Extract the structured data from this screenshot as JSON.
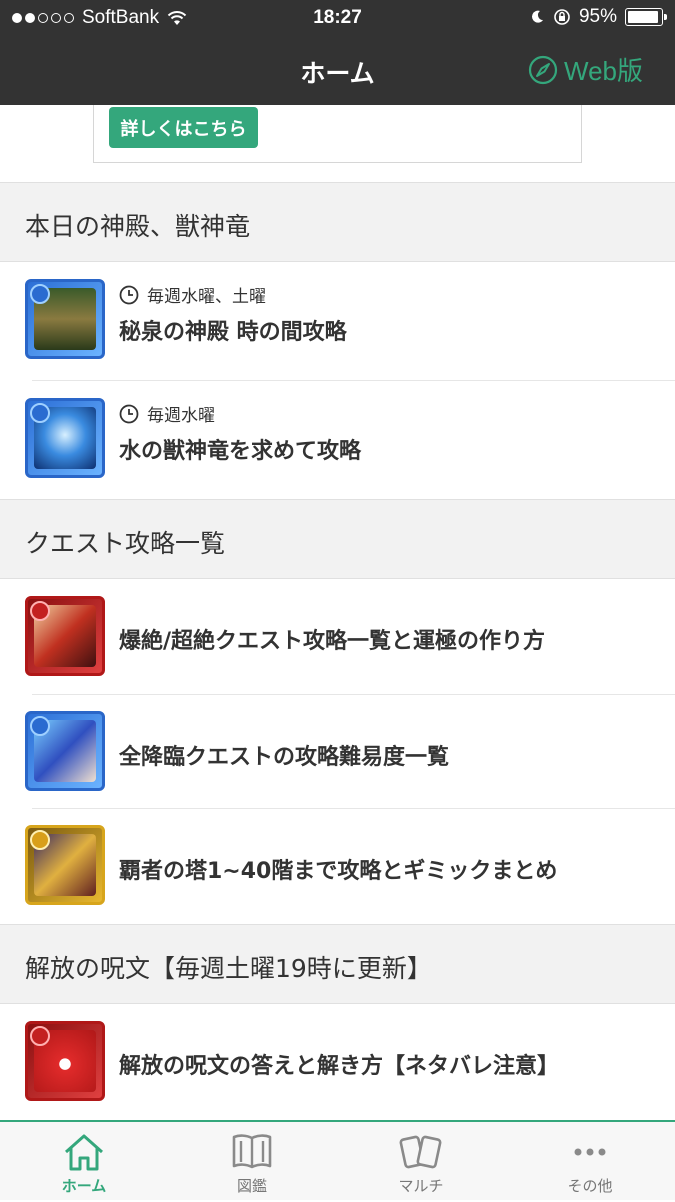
{
  "status": {
    "carrier": "SoftBank",
    "time": "18:27",
    "battery": "95%",
    "battery_level": 0.95
  },
  "nav": {
    "title": "ホーム",
    "web_label": "Web版"
  },
  "promo": {
    "button_label": "詳しくはこちら"
  },
  "sections": [
    {
      "title": "本日の神殿、獣神竜",
      "items": [
        {
          "schedule": "毎週水曜、土曜",
          "label": "秘泉の神殿 時の間攻略",
          "thumb": "temple-icon"
        },
        {
          "schedule": "毎週水曜",
          "label": "水の獣神竜を求めて攻略",
          "thumb": "water-dragon-icon"
        }
      ]
    },
    {
      "title": "クエスト攻略一覧",
      "items": [
        {
          "label": "爆絶/超絶クエスト攻略一覧と運極の作り方",
          "thumb": "fire-monster-icon"
        },
        {
          "label": "全降臨クエストの攻略難易度一覧",
          "thumb": "water-character-icon"
        },
        {
          "label": "覇者の塔1~40階まで攻略とギミックまとめ",
          "thumb": "light-character-icon"
        }
      ]
    },
    {
      "title": "解放の呪文【毎週土曜19時に更新】",
      "items": [
        {
          "label": "解放の呪文の答えと解き方【ネタバレ注意】",
          "thumb": "red-mascot-icon"
        }
      ]
    }
  ],
  "tabs": [
    {
      "label": "ホーム",
      "icon": "home-icon",
      "active": true
    },
    {
      "label": "図鑑",
      "icon": "book-icon",
      "active": false
    },
    {
      "label": "マルチ",
      "icon": "cards-icon",
      "active": false
    },
    {
      "label": "その他",
      "icon": "more-icon",
      "active": false
    }
  ],
  "colors": {
    "accent": "#34a77c",
    "bar": "#333333",
    "section_bg": "#f2f2f2"
  }
}
